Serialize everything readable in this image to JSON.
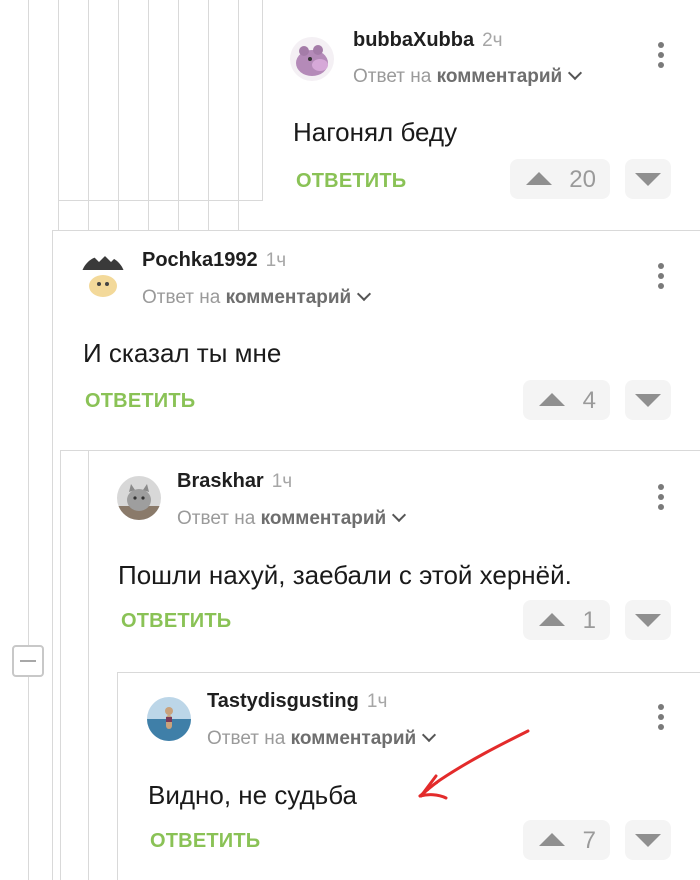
{
  "comments": [
    {
      "author": "bubbaXubba",
      "time": "2ч",
      "reply_prefix": "Ответ на",
      "reply_target": "комментарий",
      "text": "Нагонял беду",
      "reply_label": "ОТВЕТИТЬ",
      "votes": "20"
    },
    {
      "author": "Pochka1992",
      "time": "1ч",
      "reply_prefix": "Ответ на",
      "reply_target": "комментарий",
      "text": "И сказал ты мне",
      "reply_label": "ОТВЕТИТЬ",
      "votes": "4"
    },
    {
      "author": "Braskhar",
      "time": "1ч",
      "reply_prefix": "Ответ на",
      "reply_target": "комментарий",
      "text": "Пошли нахуй, заебали с этой хернёй.",
      "reply_label": "ОТВЕТИТЬ",
      "votes": "1"
    },
    {
      "author": "Tastydisgusting",
      "time": "1ч",
      "reply_prefix": "Ответ на",
      "reply_target": "комментарий",
      "text": "Видно, не судьба",
      "reply_label": "ОТВЕТИТЬ",
      "votes": "7"
    }
  ],
  "colors": {
    "reply_green": "#8ac256",
    "thread_line": "#d9d9d9",
    "annotation_red": "#e32b2b"
  },
  "icons": [
    "kebab-menu-icon",
    "chevron-down-icon",
    "upvote-arrow-icon",
    "downvote-arrow-icon",
    "collapse-thread-icon"
  ]
}
